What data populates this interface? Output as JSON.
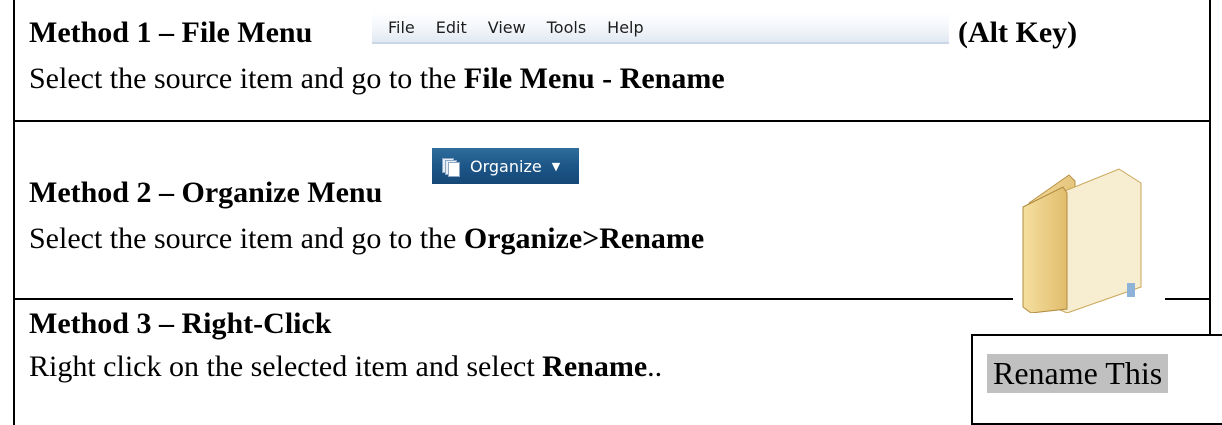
{
  "method1": {
    "heading": "Method 1 – File Menu",
    "suffix": "(Alt Key)",
    "menu_items": [
      "File",
      "Edit",
      "View",
      "Tools",
      "Help"
    ],
    "desc_prefix": "Select the source item and go to the ",
    "desc_bold": "File Menu - Rename"
  },
  "method2": {
    "heading": "Method 2 – Organize Menu",
    "button_label": "Organize",
    "button_icon": "documents-stack-icon",
    "desc_prefix": "Select the source item and go to the ",
    "desc_bold": "Organize>Rename",
    "image_icon": "folder-icon"
  },
  "method3": {
    "heading": "Method 3 – Right-Click",
    "desc_prefix": "Right click on the selected item and select ",
    "desc_bold": "Rename",
    "desc_suffix": "..",
    "rename_box_text": "Rename This"
  },
  "colors": {
    "menubar_text": "#1e1e1e",
    "organize_bg": "#1d5688",
    "rename_highlight": "#c0c0c0",
    "folder_tan": "#e8c77a"
  }
}
